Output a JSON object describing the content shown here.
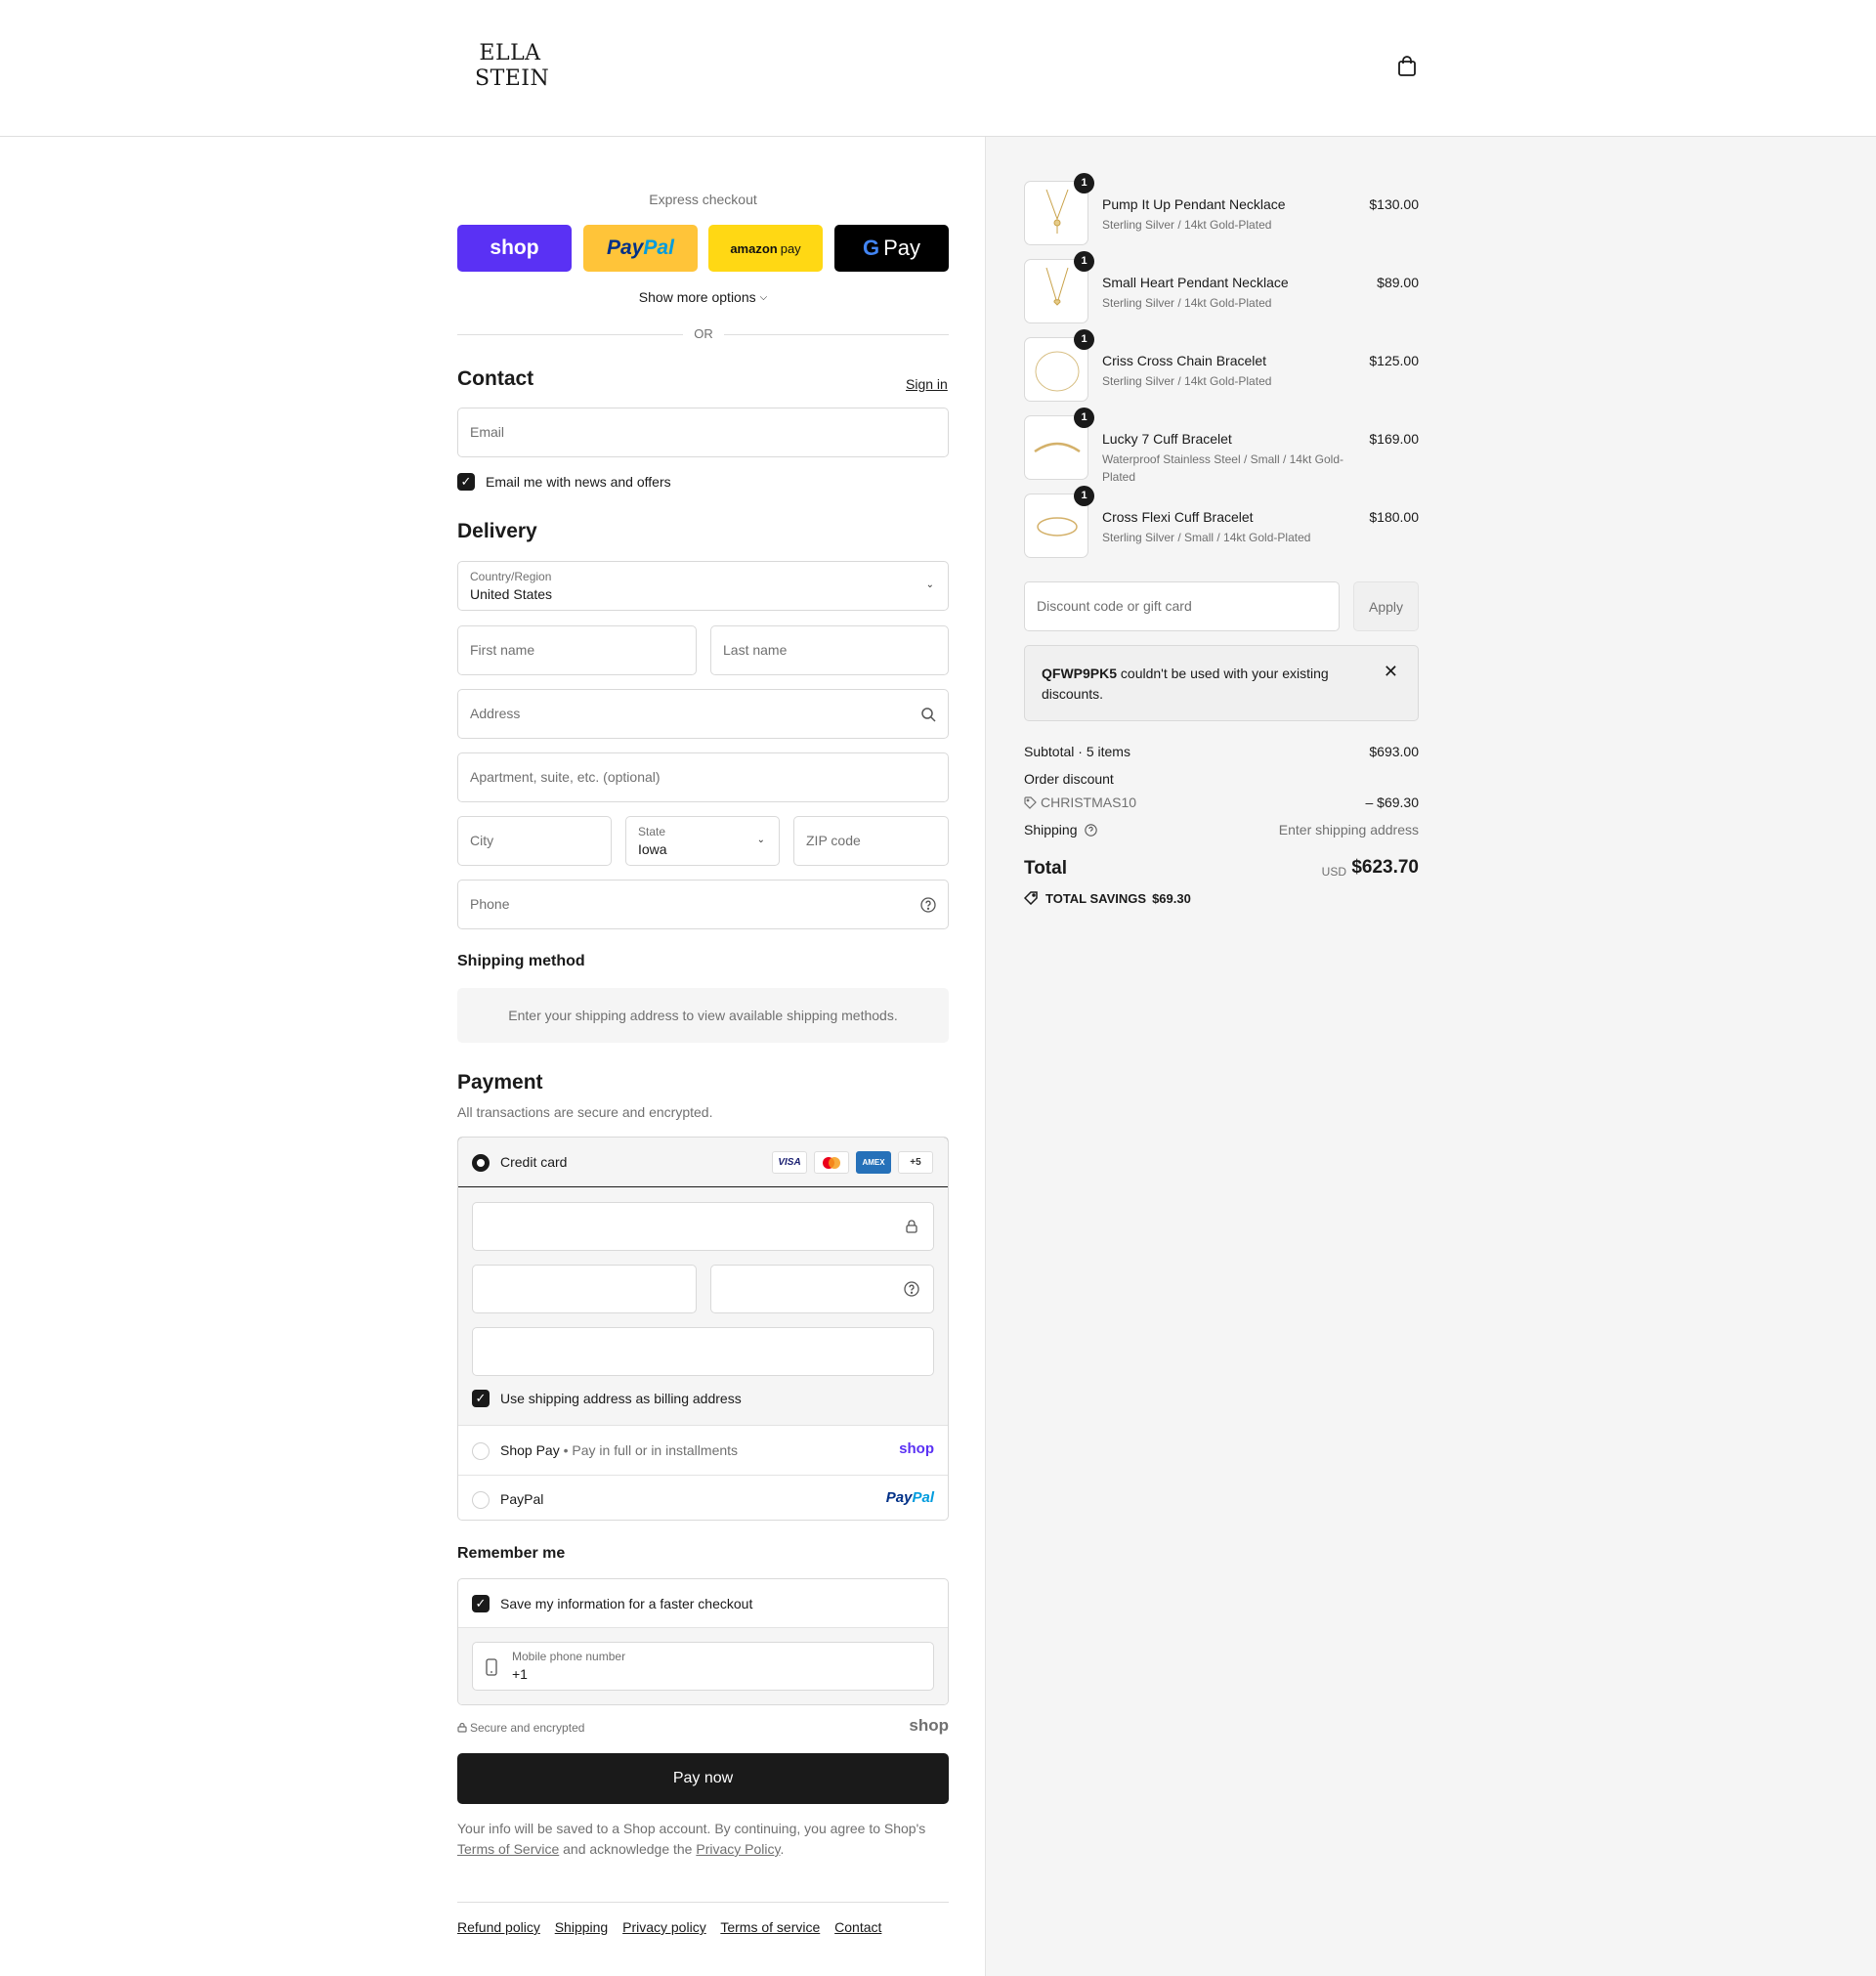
{
  "brand": {
    "line1": "ELLA",
    "line2": "STEIN"
  },
  "express": {
    "title": "Express checkout",
    "shop": "shop",
    "paypal_a": "Pay",
    "paypal_b": "Pal",
    "amazon_a": "amazon",
    "amazon_b": "pay",
    "gpay_g": "G",
    "gpay": "Pay",
    "more": "Show more options",
    "or": "OR"
  },
  "contact": {
    "title": "Contact",
    "signin": "Sign in",
    "email_placeholder": "Email",
    "news_label": "Email me with news and offers"
  },
  "delivery": {
    "title": "Delivery",
    "country_label": "Country/Region",
    "country_value": "United States",
    "first_name": "First name",
    "last_name": "Last name",
    "address": "Address",
    "apartment": "Apartment, suite, etc. (optional)",
    "city": "City",
    "state_label": "State",
    "state_value": "Iowa",
    "zip": "ZIP code",
    "phone": "Phone"
  },
  "shipping_method": {
    "title": "Shipping method",
    "info": "Enter your shipping address to view available shipping methods."
  },
  "payment": {
    "title": "Payment",
    "subtitle": "All transactions are secure and encrypted.",
    "credit_card": "Credit card",
    "cards": {
      "visa": "VISA",
      "amex": "AMEX",
      "more": "+5"
    },
    "billing_label": "Use shipping address as billing address",
    "shop_pay": "Shop Pay",
    "shop_pay_sub": "• Pay in full or in installments",
    "shop_brand": "shop",
    "paypal": "PayPal",
    "paypal_brand_a": "Pay",
    "paypal_brand_b": "Pal"
  },
  "remember": {
    "title": "Remember me",
    "save_label": "Save my information for a faster checkout",
    "phone_label": "Mobile phone number",
    "phone_value": "+1"
  },
  "secure_text": "Secure and encrypted",
  "shop_mark": "shop",
  "pay_now": "Pay now",
  "legal": {
    "part1": "Your info will be saved to a Shop account. By continuing, you agree to Shop's ",
    "terms": "Terms of Service",
    "part2": " and acknowledge the ",
    "privacy": "Privacy Policy",
    "part3": "."
  },
  "footer": [
    "Refund policy",
    "Shipping",
    "Privacy policy",
    "Terms of service",
    "Contact"
  ],
  "items": [
    {
      "qty": "1",
      "name": "Pump It Up Pendant Necklace",
      "variant": "Sterling Silver / 14kt Gold-Plated",
      "price": "$130.00"
    },
    {
      "qty": "1",
      "name": "Small Heart Pendant Necklace",
      "variant": "Sterling Silver / 14kt Gold-Plated",
      "price": "$89.00"
    },
    {
      "qty": "1",
      "name": "Criss Cross Chain Bracelet",
      "variant": "Sterling Silver / 14kt Gold-Plated",
      "price": "$125.00"
    },
    {
      "qty": "1",
      "name": "Lucky 7 Cuff Bracelet",
      "variant": "Waterproof Stainless Steel / Small / 14kt Gold-Plated",
      "price": "$169.00"
    },
    {
      "qty": "1",
      "name": "Cross Flexi Cuff Bracelet",
      "variant": "Sterling Silver / Small / 14kt Gold-Plated",
      "price": "$180.00"
    }
  ],
  "discount": {
    "placeholder": "Discount code or gift card",
    "apply": "Apply",
    "alert_code": "QFWP9PK5",
    "alert_text": " couldn't be used with your existing discounts."
  },
  "summary": {
    "subtotal_label": "Subtotal · 5 items",
    "subtotal": "$693.00",
    "order_discount": "Order discount",
    "code": "CHRISTMAS10",
    "discount_value": "– $69.30",
    "shipping_label": "Shipping",
    "shipping_value": "Enter shipping address",
    "total_label": "Total",
    "currency": "USD",
    "total": "$623.70",
    "savings_label": "TOTAL SAVINGS",
    "savings_value": "$69.30"
  }
}
